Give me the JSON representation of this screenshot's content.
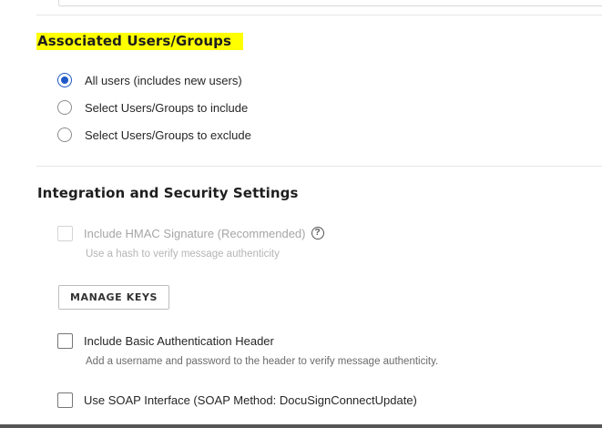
{
  "associated": {
    "title": "Associated Users/Groups",
    "options": [
      {
        "label": "All users (includes new users)",
        "checked": true
      },
      {
        "label": "Select Users/Groups to include",
        "checked": false
      },
      {
        "label": "Select Users/Groups to exclude",
        "checked": false
      }
    ]
  },
  "integration": {
    "title": "Integration and Security Settings",
    "hmac": {
      "label": "Include HMAC Signature (Recommended)",
      "help": "?",
      "description": "Use a hash to verify message authenticity",
      "disabled": true,
      "checked": false
    },
    "manage_keys_label": "MANAGE KEYS",
    "basic_auth": {
      "label": "Include Basic Authentication Header",
      "description": "Add a username and password to the header to verify message authenticity.",
      "checked": false
    },
    "soap": {
      "label": "Use SOAP Interface (SOAP Method: DocuSignConnectUpdate)",
      "checked": false
    }
  },
  "colors": {
    "accent": "#1f58c7",
    "highlight": "#ffff00"
  }
}
